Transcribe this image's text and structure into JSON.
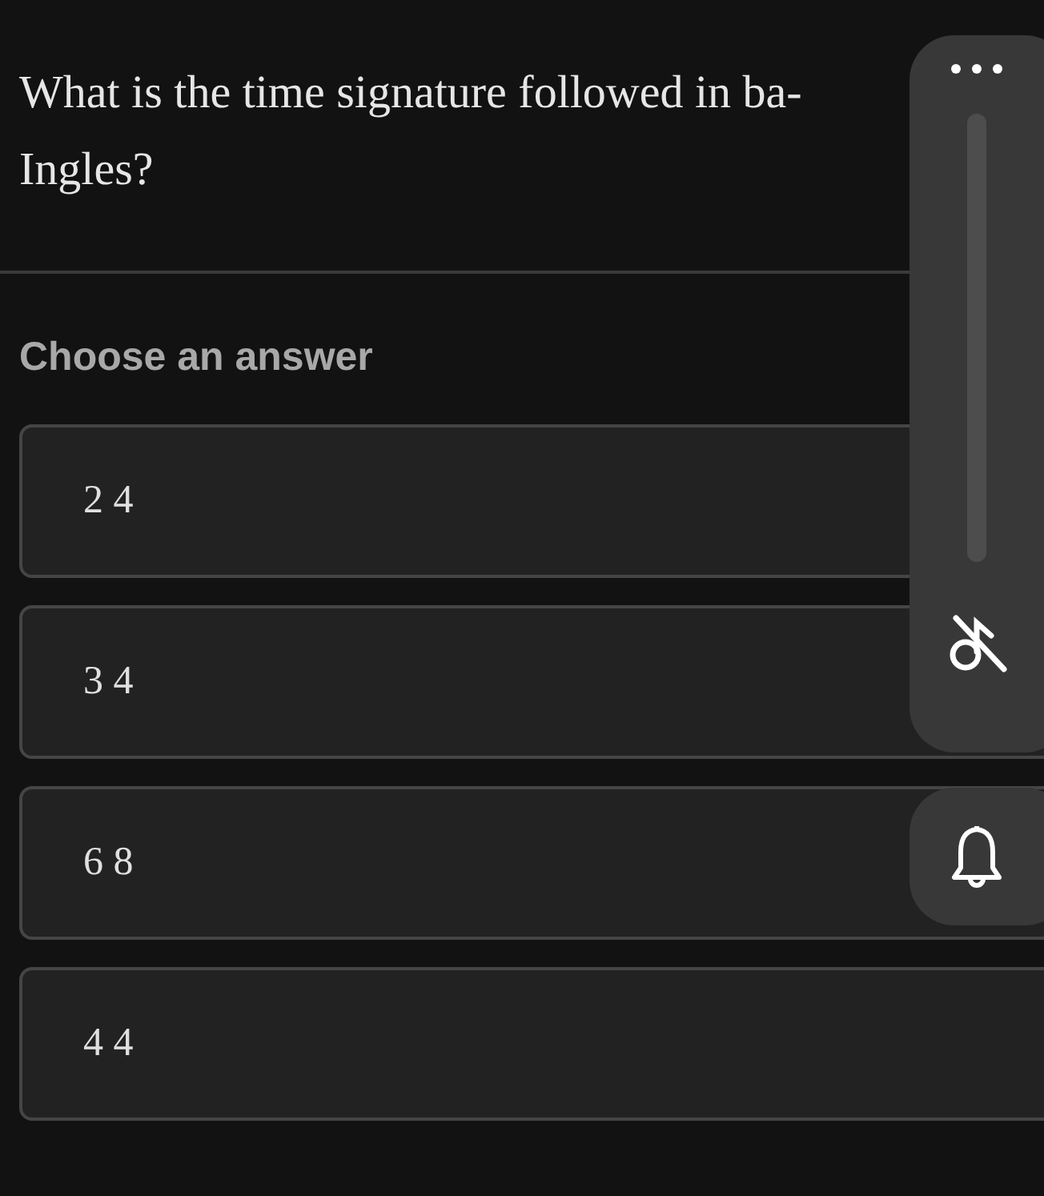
{
  "question": "What is the time signature followed in ba-Ingles?",
  "prompt": "Choose an answer",
  "answers": [
    {
      "label": "2 4"
    },
    {
      "label": "3 4"
    },
    {
      "label": "6 8"
    },
    {
      "label": "4 4"
    }
  ]
}
